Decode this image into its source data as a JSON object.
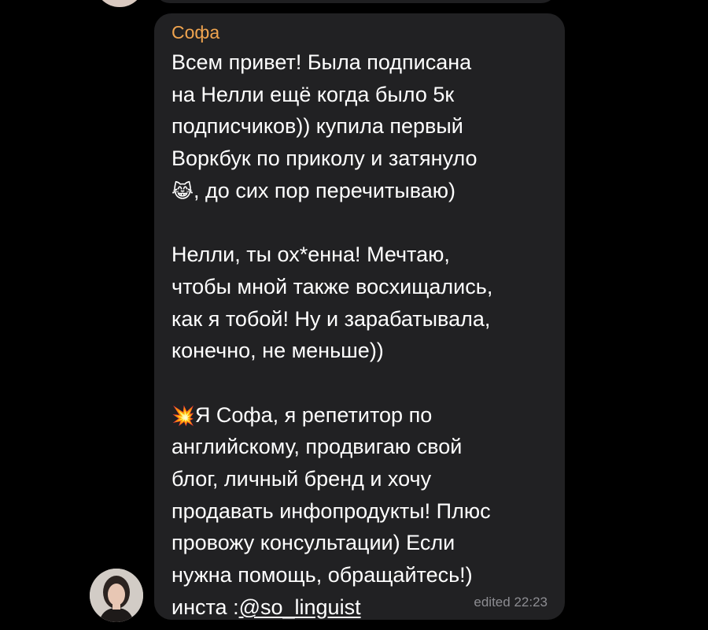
{
  "message": {
    "sender": "Софа",
    "lines": [
      "Всем привет! Была подписана",
      "на Нелли ещё когда было 5к",
      "подписчиков)) купила  первый",
      "Воркбук по приколу и затянуло",
      ", до сих пор перечитываю)",
      "Нелли, ты ох*енна! Мечтаю,",
      "чтобы мной также восхищались,",
      "как я тобой! Ну и зарабатывала,",
      "конечно, не меньше))",
      "Я Софа, я репетитор по",
      "английскому, продвигаю свой",
      "блог, личный бренд и хочу",
      "продавать инфопродукты! Плюс",
      "провожу консультации) Если",
      "нужна помощь, обращайтесь!)",
      "инста :"
    ],
    "link": "@so_linguist",
    "emoji_crying_cat": "😹",
    "emoji_collision": "💥",
    "edited_label": "edited",
    "time": "22:23"
  },
  "colors": {
    "background": "#000000",
    "bubble": "#212123",
    "sender": "#f0a44f",
    "text": "#ffffff",
    "meta": "#8d8d92"
  },
  "icons": {
    "avatar": "user-avatar-photo"
  }
}
